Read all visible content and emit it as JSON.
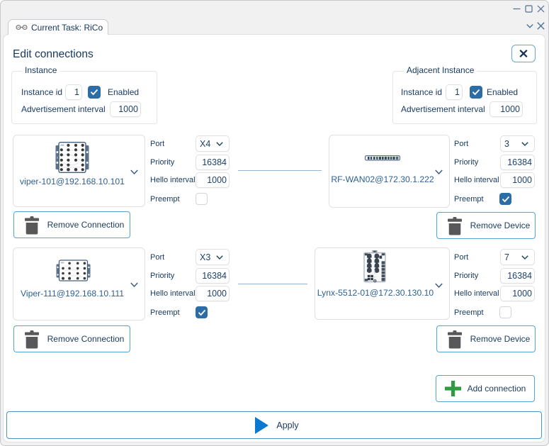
{
  "window": {
    "controls": {
      "minimize": "minimize",
      "maximize": "maximize",
      "close": "close"
    }
  },
  "tab": {
    "label": "Current Task: RiCo"
  },
  "page": {
    "title": "Edit connections"
  },
  "labels": {
    "port": "Port",
    "priority": "Priority",
    "hello": "Hello interval",
    "preempt": "Preempt",
    "instance_id": "Instance id",
    "enabled": "Enabled",
    "advertisement": "Advertisement interval"
  },
  "instance_group": {
    "legend": "Instance",
    "instance_id": "1",
    "enabled": true,
    "advertisement_interval": "1000"
  },
  "adjacent_group": {
    "legend": "Adjacent Instance",
    "instance_id": "1",
    "enabled": true,
    "advertisement_interval": "1000"
  },
  "connections": [
    {
      "left": {
        "device": "viper-101@192.168.10.101",
        "port": "X4",
        "priority": "16384",
        "hello": "1000",
        "preempt": false,
        "remove_label": "Remove Connection"
      },
      "right": {
        "device": "RF-WAN02@172.30.1.222",
        "port": "3",
        "priority": "16384",
        "hello": "1000",
        "preempt": true,
        "remove_label": "Remove Device"
      }
    },
    {
      "left": {
        "device": "Viper-111@192.168.10.111",
        "port": "X3",
        "priority": "16384",
        "hello": "1000",
        "preempt": true,
        "remove_label": "Remove Connection"
      },
      "right": {
        "device": "Lynx-5512-01@172.30.130.10",
        "port": "7",
        "priority": "16384",
        "hello": "1000",
        "preempt": false,
        "remove_label": "Remove Device"
      }
    }
  ],
  "buttons": {
    "add": "Add connection",
    "apply": "Apply"
  },
  "colors": {
    "accent_blue": "#2d6da6",
    "button_border": "#54a5d6",
    "green_plus": "#2f9b40",
    "play_blue": "#0b79d0",
    "navy_text": "#17375d"
  }
}
